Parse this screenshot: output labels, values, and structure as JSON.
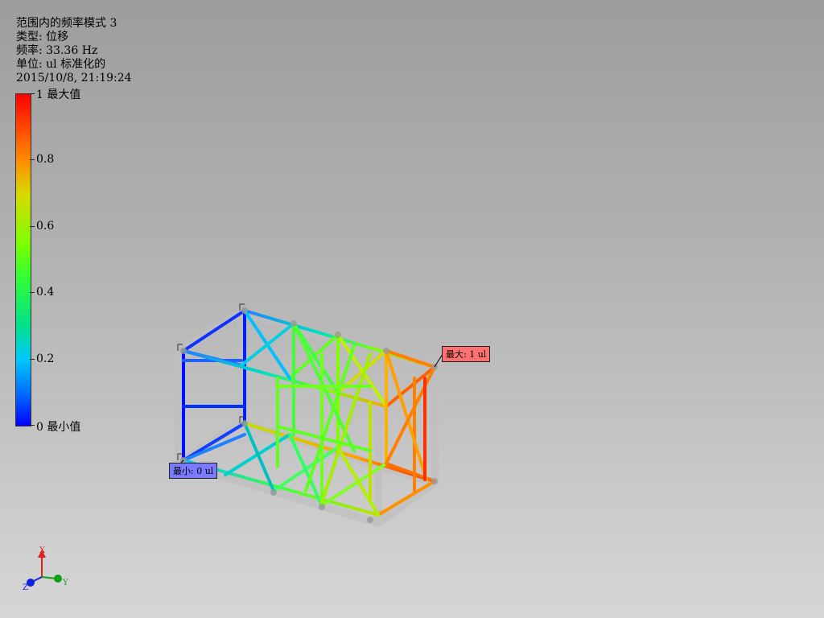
{
  "info": {
    "title": "范围内的频率模式 3",
    "type_line": "类型: 位移",
    "freq_line": "频率: 33.36 Hz",
    "unit_line": "单位: ul 标准化的",
    "timestamp": "2015/10/8, 21:19:24"
  },
  "legend": {
    "ticks": [
      {
        "label": "1 最大值"
      },
      {
        "label": "0.8"
      },
      {
        "label": "0.6"
      },
      {
        "label": "0.4"
      },
      {
        "label": "0.2"
      },
      {
        "label": "0 最小值"
      }
    ]
  },
  "probes": {
    "max_label": "最大: 1 ul",
    "min_label": "最小: 0 ul",
    "max_color": "#ff7070",
    "min_color": "#7a7aff"
  },
  "triad": {
    "x_label": "X",
    "y_label": "Y",
    "z_label": "Z"
  },
  "colors": {
    "max": "#ff0000",
    "mid_high": "#ffa500",
    "mid": "#7fff00",
    "mid_low": "#00e0a0",
    "low": "#0000ff"
  }
}
